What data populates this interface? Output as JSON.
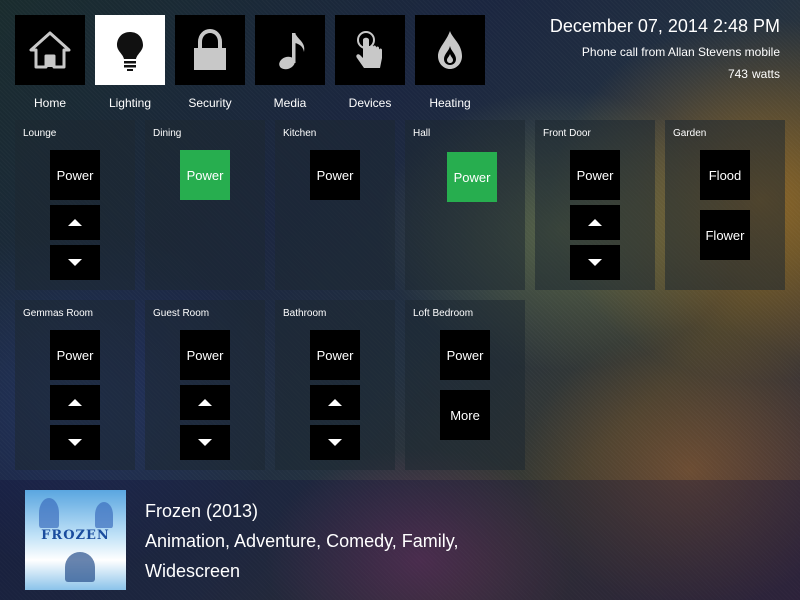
{
  "nav": {
    "items": [
      {
        "label": "Home",
        "icon": "home-icon"
      },
      {
        "label": "Lighting",
        "icon": "lightbulb-icon",
        "active": true
      },
      {
        "label": "Security",
        "icon": "lock-icon"
      },
      {
        "label": "Media",
        "icon": "music-note-icon"
      },
      {
        "label": "Devices",
        "icon": "touch-hand-icon"
      },
      {
        "label": "Heating",
        "icon": "flame-icon"
      }
    ]
  },
  "status": {
    "datetime": "December 07, 2014 2:48 PM",
    "notification": "Phone call from Allan Stevens mobile",
    "power_value": "743",
    "power_unit": "watts"
  },
  "rooms": [
    {
      "name": "Lounge",
      "power": "Power"
    },
    {
      "name": "Dining",
      "power": "Power"
    },
    {
      "name": "Kitchen",
      "power": "Power"
    },
    {
      "name": "Hall",
      "power": "Power"
    },
    {
      "name": "Front Door",
      "power": "Power"
    },
    {
      "name": "Garden",
      "buttons": [
        "Flood",
        "Flower"
      ]
    },
    {
      "name": "Gemmas Room",
      "power": "Power"
    },
    {
      "name": "Guest Room",
      "power": "Power"
    },
    {
      "name": "Bathroom",
      "power": "Power"
    },
    {
      "name": "Loft Bedroom",
      "power": "Power",
      "more": "More"
    }
  ],
  "colors": {
    "active_power": "#27ae4f",
    "active_nav": "#ffffff"
  },
  "now_playing": {
    "poster_text": "FROZEN",
    "title": "Frozen (2013)",
    "genres": "Animation, Adventure, Comedy, Family,",
    "format": "Widescreen"
  }
}
